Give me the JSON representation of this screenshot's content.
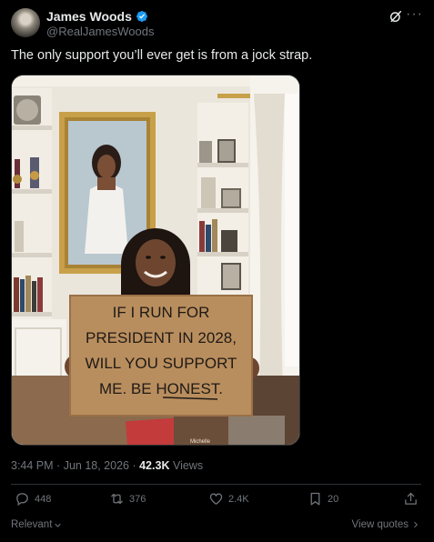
{
  "author": {
    "name": "James Woods",
    "handle": "@RealJamesWoods",
    "verified": true,
    "verified_color": "#1d9bf0"
  },
  "tweet": {
    "text": "The only support you’ll ever get is from a jock strap."
  },
  "image": {
    "sign_lines": [
      "IF I RUN FOR",
      "PRESIDENT IN 2028,",
      "WILL YOU SUPPORT",
      "ME. BE HONEST."
    ],
    "magazine_label": "Michelle"
  },
  "meta": {
    "time": "3:44 PM",
    "date": "Jun 18, 2026",
    "views_count": "42.3K",
    "views_label": "Views"
  },
  "actions": {
    "replies": "448",
    "reposts": "376",
    "likes": "2.4K",
    "bookmarks": "20"
  },
  "footer": {
    "sort_label": "Relevant",
    "view_quotes_label": "View quotes"
  },
  "icons": [
    "grok-icon",
    "more-icon",
    "reply-icon",
    "repost-icon",
    "like-icon",
    "bookmark-icon",
    "share-icon",
    "chevron-down-icon",
    "chevron-right-icon",
    "verified-icon"
  ]
}
